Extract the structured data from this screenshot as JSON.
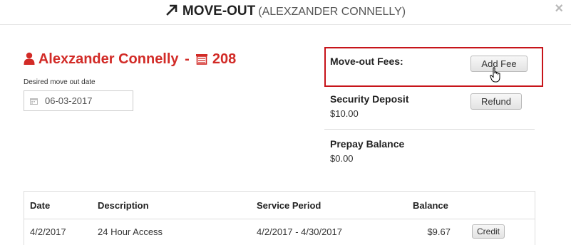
{
  "header": {
    "title": "MOVE-OUT",
    "subtitle": "(ALEXZANDER CONNELLY)",
    "close_label": "×"
  },
  "tenant": {
    "name": "Alexzander Connelly",
    "separator": "-",
    "unit": "208",
    "accent_color": "#d22b27"
  },
  "move_out_date": {
    "label": "Desired move out date",
    "value": "06-03-2017"
  },
  "fees": {
    "label": "Move-out Fees:",
    "add_button": "Add Fee"
  },
  "security_deposit": {
    "label": "Security Deposit",
    "value": "$10.00",
    "button": "Refund"
  },
  "prepay": {
    "label": "Prepay Balance",
    "value": "$0.00"
  },
  "table": {
    "headers": [
      "Date",
      "Description",
      "Service Period",
      "Balance"
    ],
    "rows": [
      {
        "date": "4/2/2017",
        "description": "24 Hour Access",
        "service_period": "4/2/2017 - 4/30/2017",
        "balance": "$9.67",
        "action": "Credit"
      }
    ]
  }
}
